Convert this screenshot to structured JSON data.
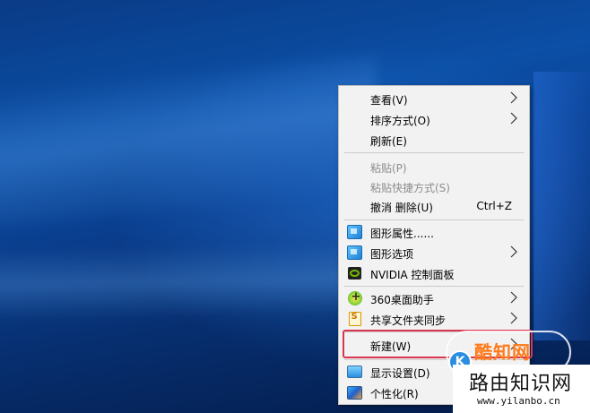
{
  "menu": {
    "items": [
      {
        "label": "查看(V)",
        "submenu": true
      },
      {
        "label": "排序方式(O)",
        "submenu": true
      },
      {
        "label": "刷新(E)"
      },
      {
        "label": "粘贴(P)",
        "disabled": true
      },
      {
        "label": "粘贴快捷方式(S)",
        "disabled": true
      },
      {
        "label": "撤消 删除(U)",
        "shortcut": "Ctrl+Z"
      },
      {
        "label": "图形属性......",
        "icon": "intel-graphics-icon"
      },
      {
        "label": "图形选项",
        "icon": "intel-graphics-icon",
        "submenu": true
      },
      {
        "label": "NVIDIA 控制面板",
        "icon": "nvidia-icon"
      },
      {
        "label": "360桌面助手",
        "icon": "360-desktop-icon",
        "submenu": true
      },
      {
        "label": "共享文件夹同步",
        "icon": "shared-folder-icon",
        "submenu": true
      },
      {
        "label": "新建(W)",
        "submenu": true,
        "highlighted": true
      },
      {
        "label": "显示设置(D)",
        "icon": "display-settings-icon"
      },
      {
        "label": "个性化(R)",
        "icon": "personalize-icon"
      }
    ]
  },
  "highlight_color": "#d9354f",
  "watermark": {
    "badge_text": "酷知网",
    "badge_logo": "K",
    "title": "路由知识网",
    "url": "www.yilanbo.cn"
  }
}
